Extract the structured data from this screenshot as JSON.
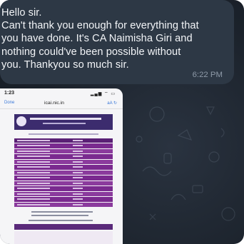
{
  "message": {
    "text": "Hello sir.\nCan't thank you enough for everything that\nyou have done. It's CA Naimisha Giri and\nnothing could've been possible without\nyou. Thankyou so much sir.",
    "time": "6:22 PM"
  },
  "screenshot": {
    "status_time": "1:23",
    "url": "icai.nic.in",
    "url_left": "Done",
    "url_right": "aA  ↻",
    "status_icons": "▂▄▆ ⌔ ▭"
  },
  "colors": {
    "bubble": "#2d3845",
    "chat_background": "#1b222b",
    "site_header": "#3c2c6e",
    "table_rows": "#7a2a8f"
  }
}
